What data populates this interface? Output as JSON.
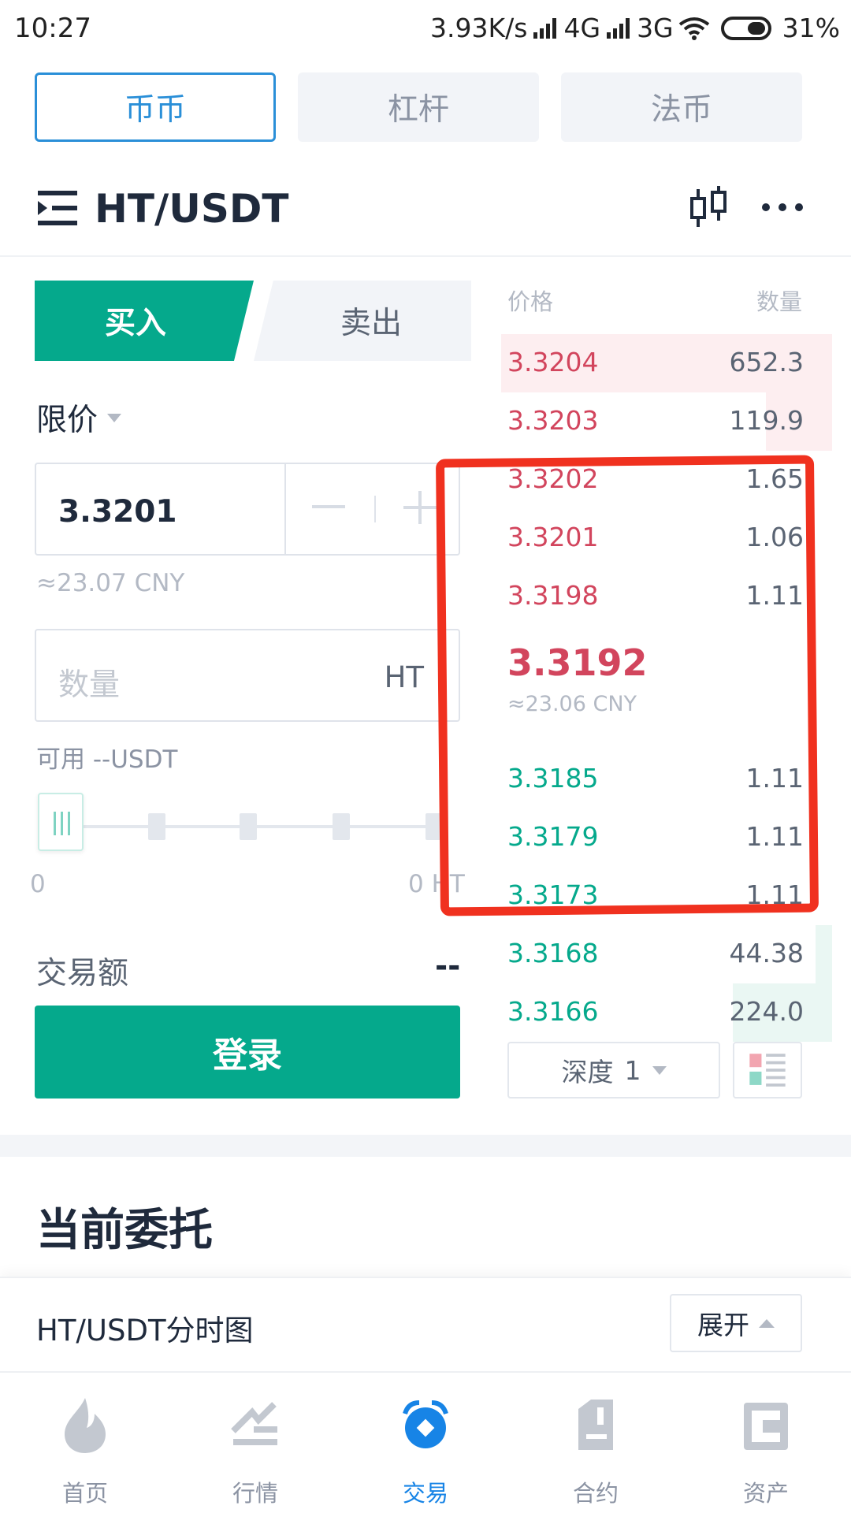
{
  "status_bar": {
    "time": "10:27",
    "net_speed": "3.93K/s",
    "net1": "4G",
    "net2": "3G",
    "battery": "31%"
  },
  "market_tabs": [
    {
      "label": "币币",
      "active": true
    },
    {
      "label": "杠杆",
      "active": false
    },
    {
      "label": "法币",
      "active": false
    }
  ],
  "header": {
    "pair": "HT/USDT",
    "icons": [
      "menu-icon",
      "kline-icon",
      "more-icon"
    ]
  },
  "trade_form": {
    "buy_label": "买入",
    "sell_label": "卖出",
    "order_type": "限价",
    "price_value": "3.3201",
    "price_cny": "≈23.07 CNY",
    "amount_placeholder": "数量",
    "amount_unit": "HT",
    "available": "可用 --USDT",
    "slider_min": "0",
    "slider_max": "0 HT",
    "slider_level": 0,
    "total_label": "交易额",
    "total_value": "--",
    "submit_label": "登录"
  },
  "order_book": {
    "price_header": "价格",
    "qty_header": "数量",
    "asks": [
      {
        "price": "3.3204",
        "qty": "652.3",
        "depth": 1.0
      },
      {
        "price": "3.3203",
        "qty": "119.9",
        "depth": 0.2
      },
      {
        "price": "3.3202",
        "qty": "1.65",
        "depth": 0.0
      },
      {
        "price": "3.3201",
        "qty": "1.06",
        "depth": 0.0
      },
      {
        "price": "3.3198",
        "qty": "1.11",
        "depth": 0.0
      }
    ],
    "last_price": "3.3192",
    "last_price_cny": "≈23.06 CNY",
    "bids": [
      {
        "price": "3.3185",
        "qty": "1.11",
        "depth": 0.0
      },
      {
        "price": "3.3179",
        "qty": "1.11",
        "depth": 0.0
      },
      {
        "price": "3.3173",
        "qty": "1.11",
        "depth": 0.0
      },
      {
        "price": "3.3168",
        "qty": "44.38",
        "depth": 0.05
      },
      {
        "price": "3.3166",
        "qty": "224.0",
        "depth": 0.3
      }
    ],
    "depth_label": "深度",
    "depth_value": "1"
  },
  "colors": {
    "accent_green": "#05a98c",
    "ask_red": "#d2455d",
    "tab_blue": "#2a8fd8",
    "annotation_red": "#f0311f"
  },
  "current_orders": {
    "title": "当前委托"
  },
  "chart_bar": {
    "title": "HT/USDT分时图",
    "expand_label": "展开"
  },
  "bottom_nav": [
    {
      "label": "首页",
      "icon": "fire-icon",
      "active": false
    },
    {
      "label": "行情",
      "icon": "market-icon",
      "active": false
    },
    {
      "label": "交易",
      "icon": "trade-icon",
      "active": true
    },
    {
      "label": "合约",
      "icon": "contract-icon",
      "active": false
    },
    {
      "label": "资产",
      "icon": "wallet-icon",
      "active": false
    }
  ]
}
